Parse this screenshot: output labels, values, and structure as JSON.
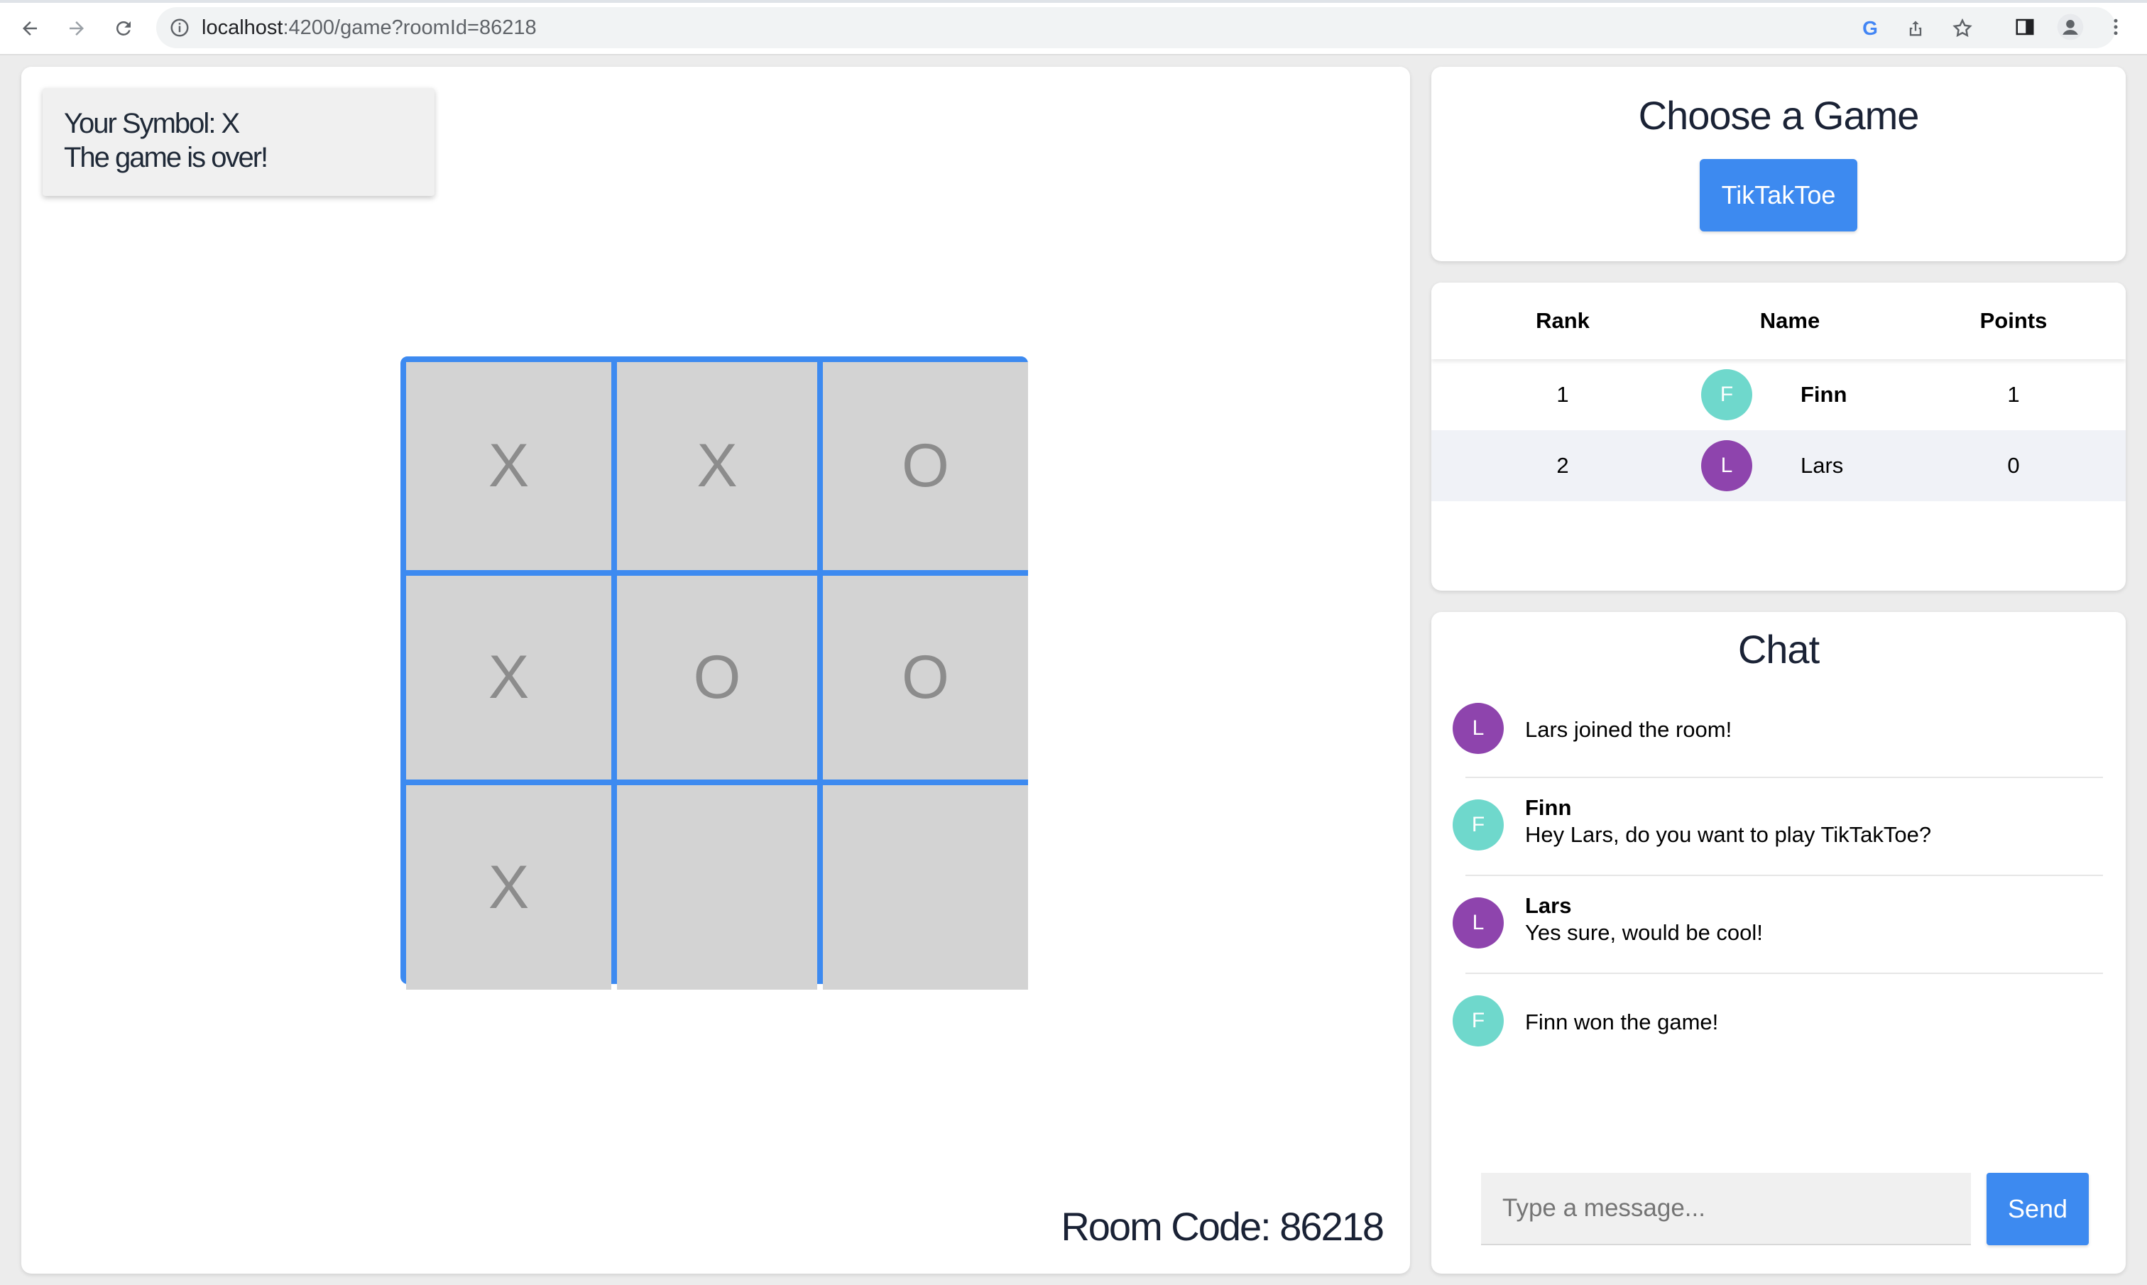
{
  "browser": {
    "url_host": "localhost",
    "url_path": ":4200/game?roomId=86218"
  },
  "game": {
    "symbol_line": "Your Symbol: X",
    "status_line": "The game is over!",
    "board": [
      "X",
      "X",
      "O",
      "X",
      "O",
      "O",
      "X",
      "",
      ""
    ],
    "room_code": "Room Code: 86218"
  },
  "choose": {
    "title": "Choose a Game",
    "button": "TikTakToe"
  },
  "ranking": {
    "headers": {
      "rank": "Rank",
      "name": "Name",
      "points": "Points"
    },
    "rows": [
      {
        "rank": "1",
        "initial": "F",
        "name": "Finn",
        "points": "1",
        "avatar_color": "#6fd8cc"
      },
      {
        "rank": "2",
        "initial": "L",
        "name": "Lars",
        "points": "0",
        "avatar_color": "#8e44ad"
      }
    ]
  },
  "chat": {
    "title": "Chat",
    "messages": [
      {
        "initial": "L",
        "author": "",
        "text": "Lars joined the room!"
      },
      {
        "initial": "F",
        "author": "Finn",
        "text": "Hey Lars, do you want to play TikTakToe?"
      },
      {
        "initial": "L",
        "author": "Lars",
        "text": "Yes sure, would be cool!"
      },
      {
        "initial": "F",
        "author": "",
        "text": "Finn won the game!"
      }
    ],
    "placeholder": "Type a message...",
    "send_label": "Send"
  },
  "colors": {
    "accent": "#3d8af0",
    "avatar_f": "#6fd8cc",
    "avatar_l": "#8e44ad",
    "cell_bg": "#d3d3d3"
  }
}
